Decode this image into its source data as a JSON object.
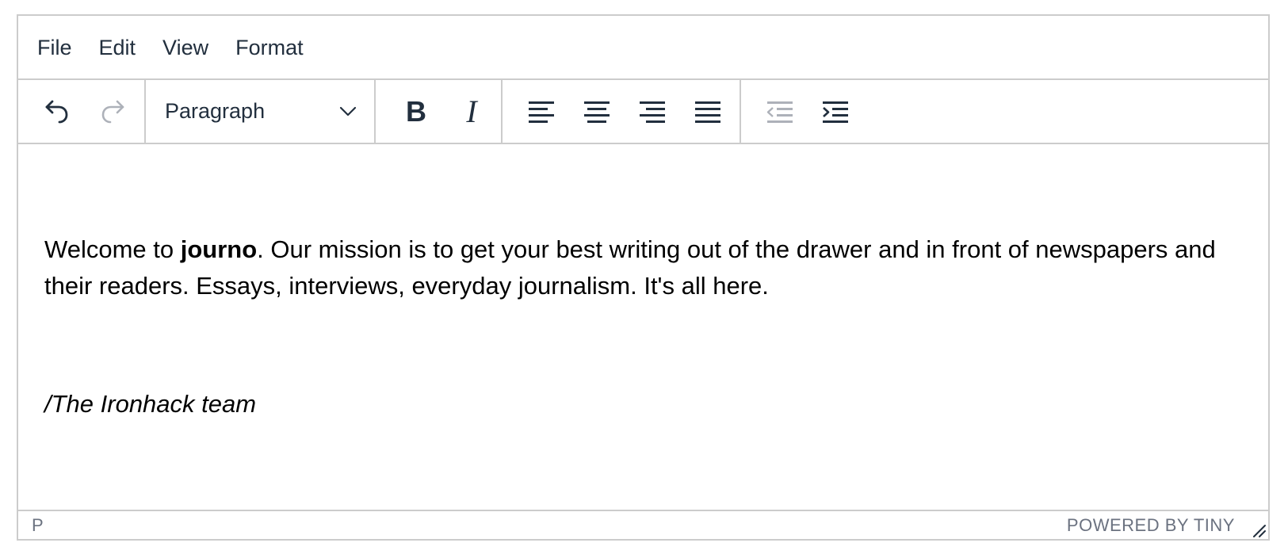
{
  "menubar": {
    "items": [
      {
        "label": "File"
      },
      {
        "label": "Edit"
      },
      {
        "label": "View"
      },
      {
        "label": "Format"
      }
    ]
  },
  "toolbar": {
    "history": {
      "undo_icon": "undo-icon",
      "redo_icon": "redo-icon",
      "redo_disabled": true
    },
    "blocks": {
      "selected": "Paragraph",
      "chevron_icon": "chevron-down-icon"
    },
    "format": {
      "bold_glyph": "B",
      "italic_glyph": "I"
    },
    "align": {
      "icons": [
        "align-left-icon",
        "align-center-icon",
        "align-right-icon",
        "align-justify-icon"
      ]
    },
    "indent": {
      "outdent_icon": "outdent-icon",
      "indent_icon": "indent-icon",
      "outdent_disabled": true
    }
  },
  "content": {
    "paragraph": {
      "before": "Welcome to ",
      "bold": "journo",
      "after": ". Our mission is to get your best writing out of the drawer and in front of newspapers and their readers. Essays, interviews, everyday journalism. It's all here."
    },
    "signature": "/The Ironhack team"
  },
  "statusbar": {
    "path": "P",
    "branding": "POWERED BY TINY",
    "resize_icon": "resize-handle-icon"
  },
  "colors": {
    "border": "#cccccc",
    "text": "#222f3e",
    "content_text": "#000000",
    "status_text": "#6b7280"
  }
}
